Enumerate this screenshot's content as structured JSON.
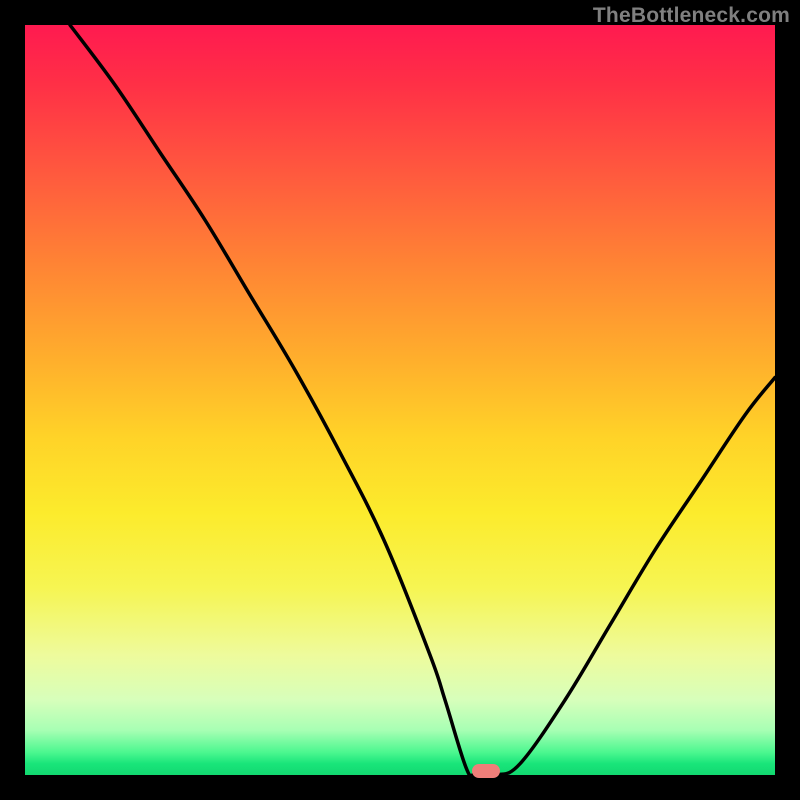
{
  "attribution": "TheBottleneck.com",
  "colors": {
    "markerFill": "#ef7e79",
    "curveStroke": "#000000"
  },
  "chart_data": {
    "type": "line",
    "title": "",
    "xlabel": "",
    "ylabel": "",
    "xlim": [
      0,
      100
    ],
    "ylim": [
      0,
      100
    ],
    "grid": false,
    "legend": false,
    "series": [
      {
        "name": "bottleneck_curve",
        "x": [
          6,
          12,
          18,
          24,
          30,
          36,
          42,
          48,
          54,
          56,
          58.8,
          60,
          62.8,
          66,
          72,
          78,
          84,
          90,
          96,
          100
        ],
        "y": [
          100,
          92,
          83,
          74,
          64,
          54,
          43,
          31,
          16,
          10,
          1,
          0,
          0,
          1.5,
          10,
          20,
          30,
          39,
          48,
          53
        ]
      }
    ],
    "marker": {
      "x": 61.5,
      "y": 0.5
    }
  }
}
